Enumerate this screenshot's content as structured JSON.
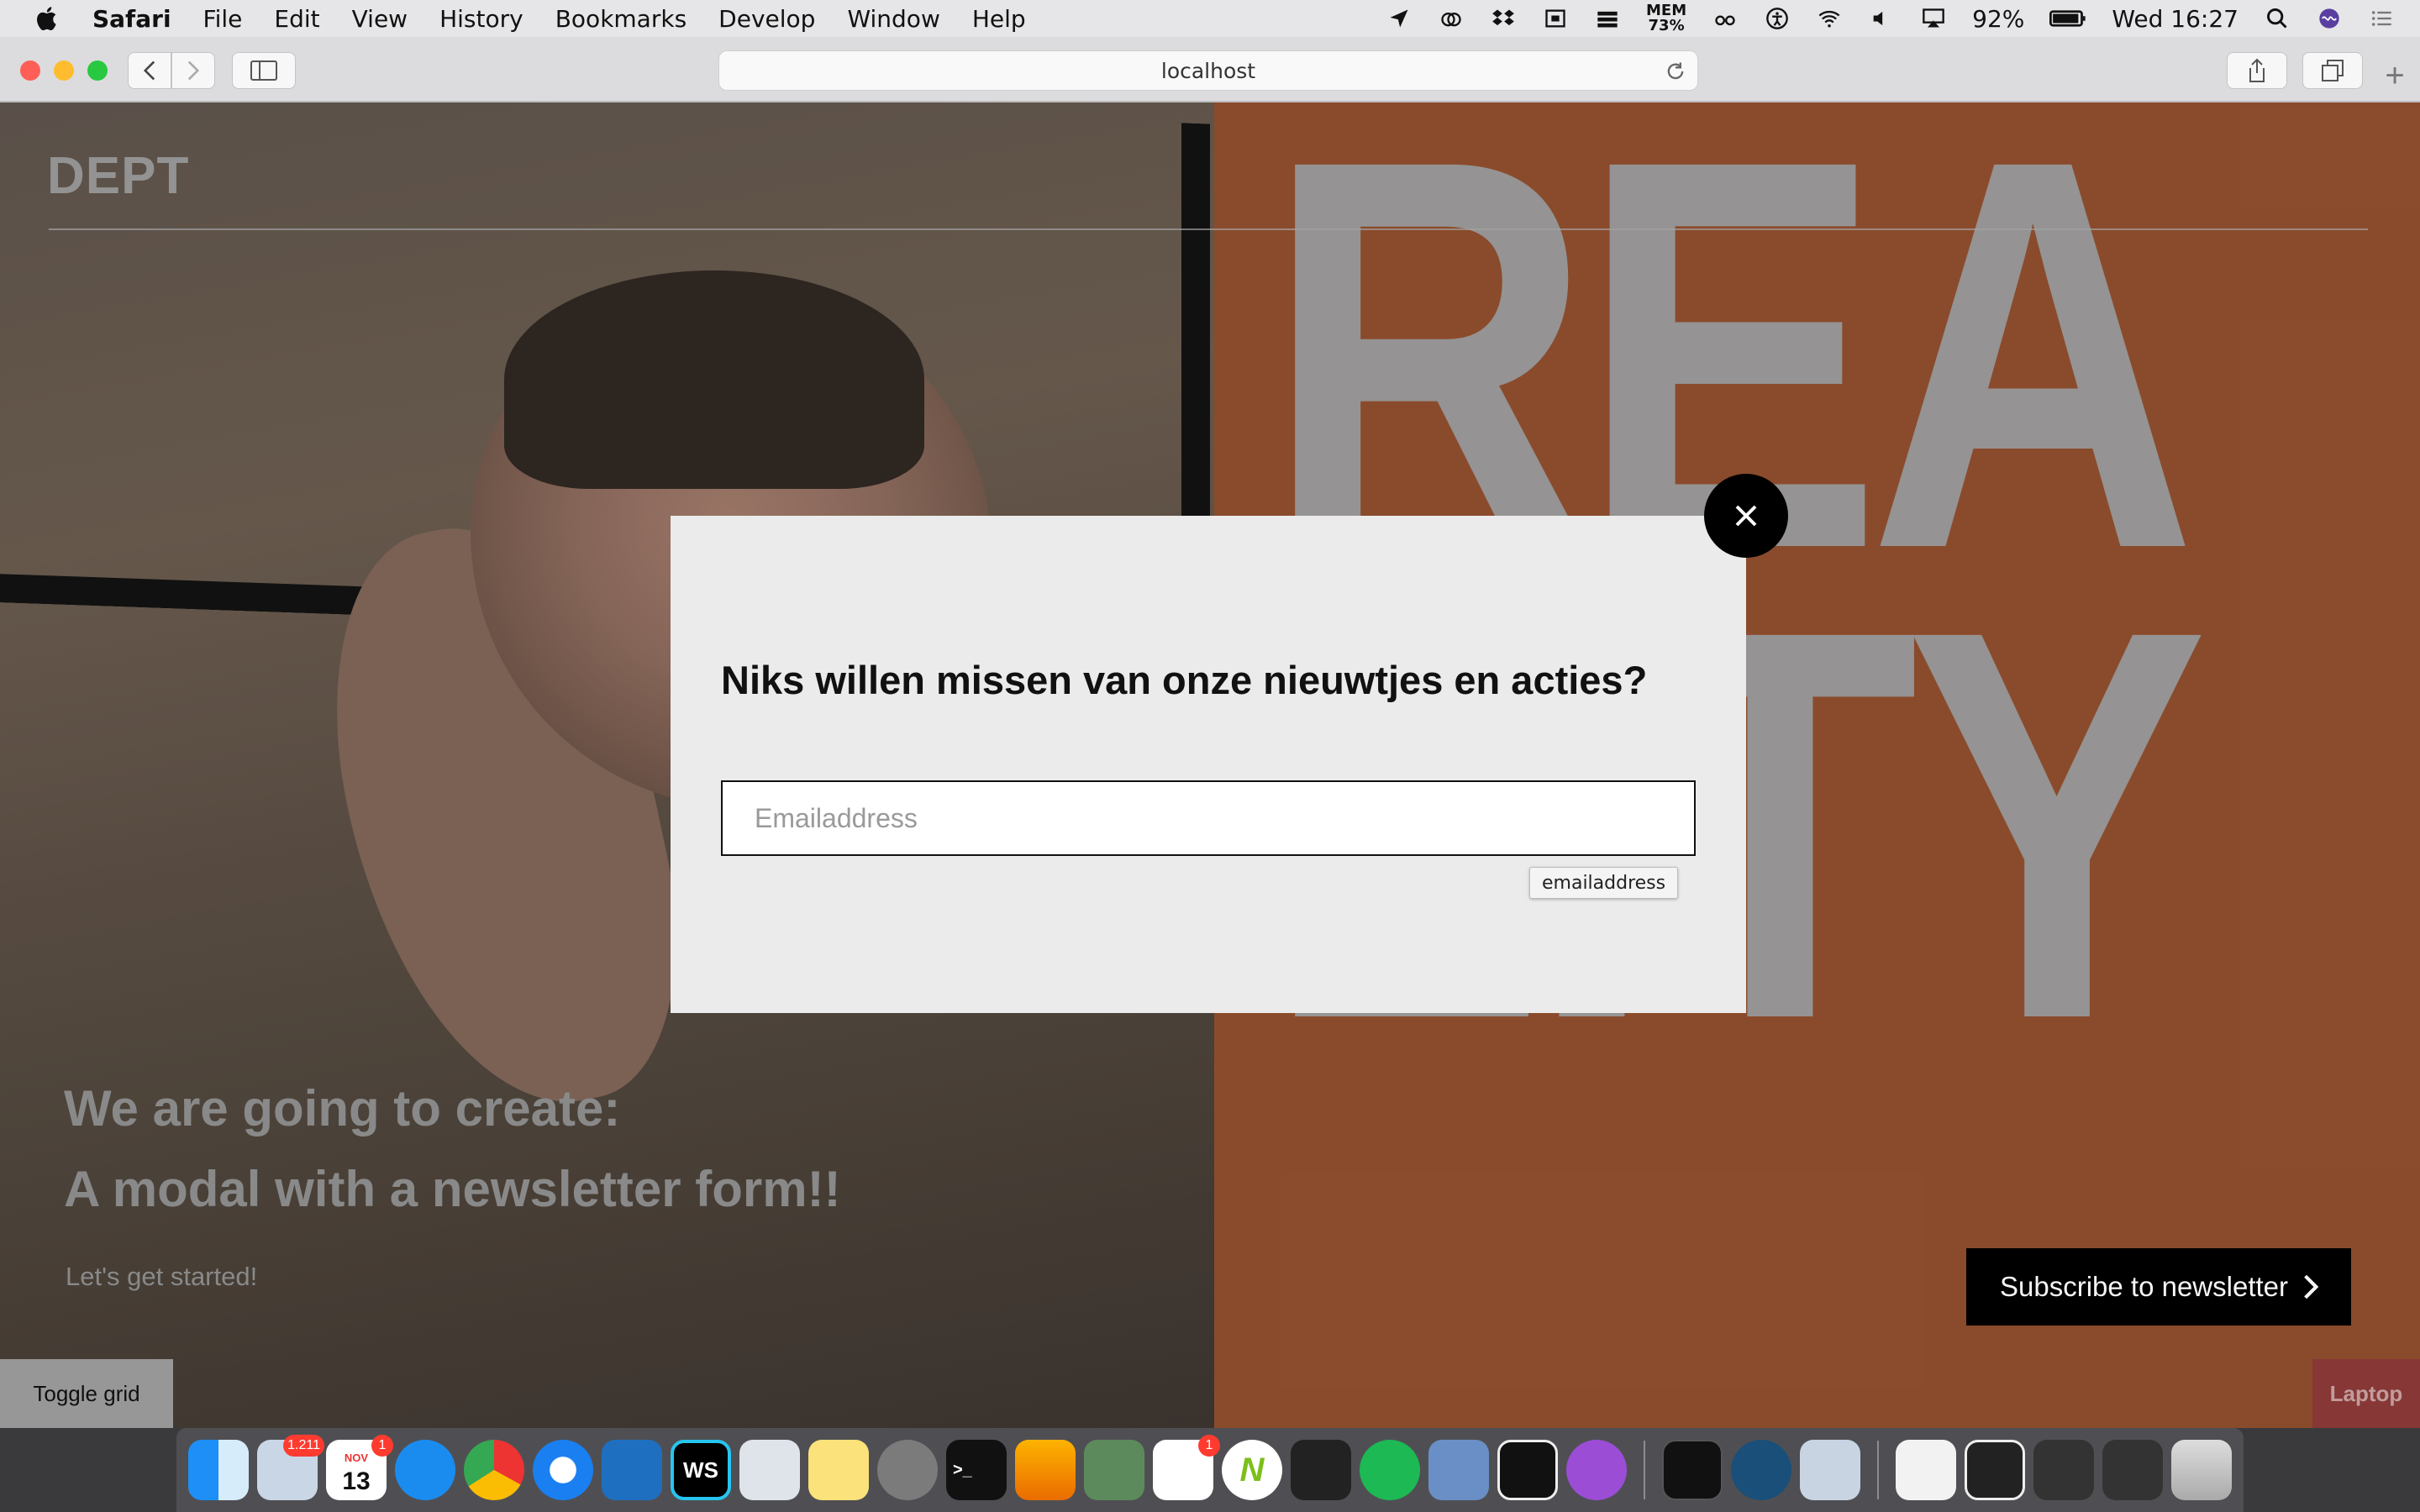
{
  "menubar": {
    "app_name": "Safari",
    "items": [
      "File",
      "Edit",
      "View",
      "History",
      "Bookmarks",
      "Develop",
      "Window",
      "Help"
    ],
    "mem_label": "MEM",
    "mem_value": "73%",
    "battery": "92%",
    "clock": "Wed 16:27"
  },
  "browser": {
    "url": "localhost"
  },
  "page": {
    "logo": "DEPT",
    "poster_text": [
      "REA",
      "LITY"
    ],
    "hero_line1": "We are going to create:",
    "hero_line2": "A modal with a newsletter form!!",
    "hero_sub": "Let's get started!",
    "subscribe_label": "Subscribe to newsletter",
    "toggle_grid": "Toggle grid",
    "breakpoint_badge": "Laptop"
  },
  "modal": {
    "title": "Niks willen missen van onze nieuwtjes en acties?",
    "email_placeholder": "Emailaddress",
    "email_tooltip": "emailaddress"
  },
  "dock": {
    "mail_badge": "1.211",
    "calendar_month": "NOV",
    "calendar_day": "13",
    "calendar_badge": "1",
    "slack_badge": "1"
  },
  "colors": {
    "poster_bg": "#904f2e",
    "modal_bg": "#ebebeb",
    "button_bg": "#000000",
    "laptop_badge": "#8d3a38"
  }
}
